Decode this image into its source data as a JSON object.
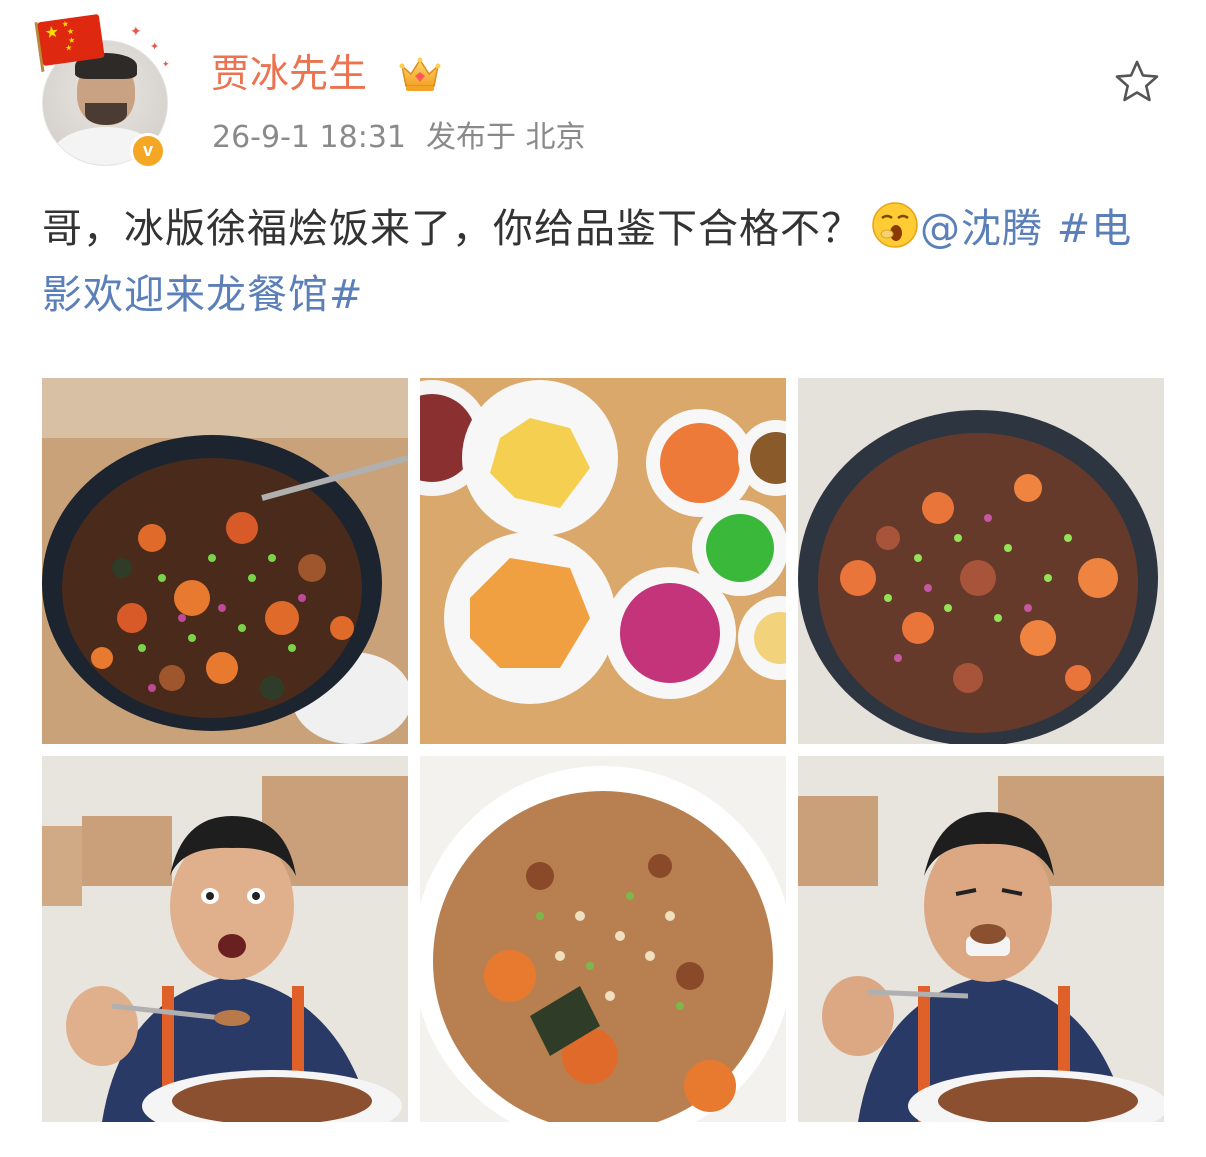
{
  "user": {
    "name": "贾冰先生",
    "timestamp": "26-9-1 18:31",
    "location_label": "发布于 北京"
  },
  "post": {
    "text": "哥，冰版徐福烩饭来了，你给品鉴下合格不？",
    "mention": "@沈腾",
    "hashtag": "#电影欢迎来龙餐馆#"
  },
  "photos": [
    {
      "name": "photo-wok-stirfry"
    },
    {
      "name": "photo-ingredients"
    },
    {
      "name": "photo-wok-steaming"
    },
    {
      "name": "photo-man-eating-1"
    },
    {
      "name": "photo-fried-rice"
    },
    {
      "name": "photo-man-eating-2"
    }
  ],
  "colors": {
    "username": "#eb7350",
    "link": "#5b7fb8",
    "text": "#333333",
    "meta": "#8a8a8a",
    "vip_badge": "#f5a623"
  },
  "icons": {
    "verified": "verified-v-icon",
    "vip": "crown-icon",
    "favorite": "star-outline-icon",
    "emoji": "yawn-emoji-icon"
  }
}
